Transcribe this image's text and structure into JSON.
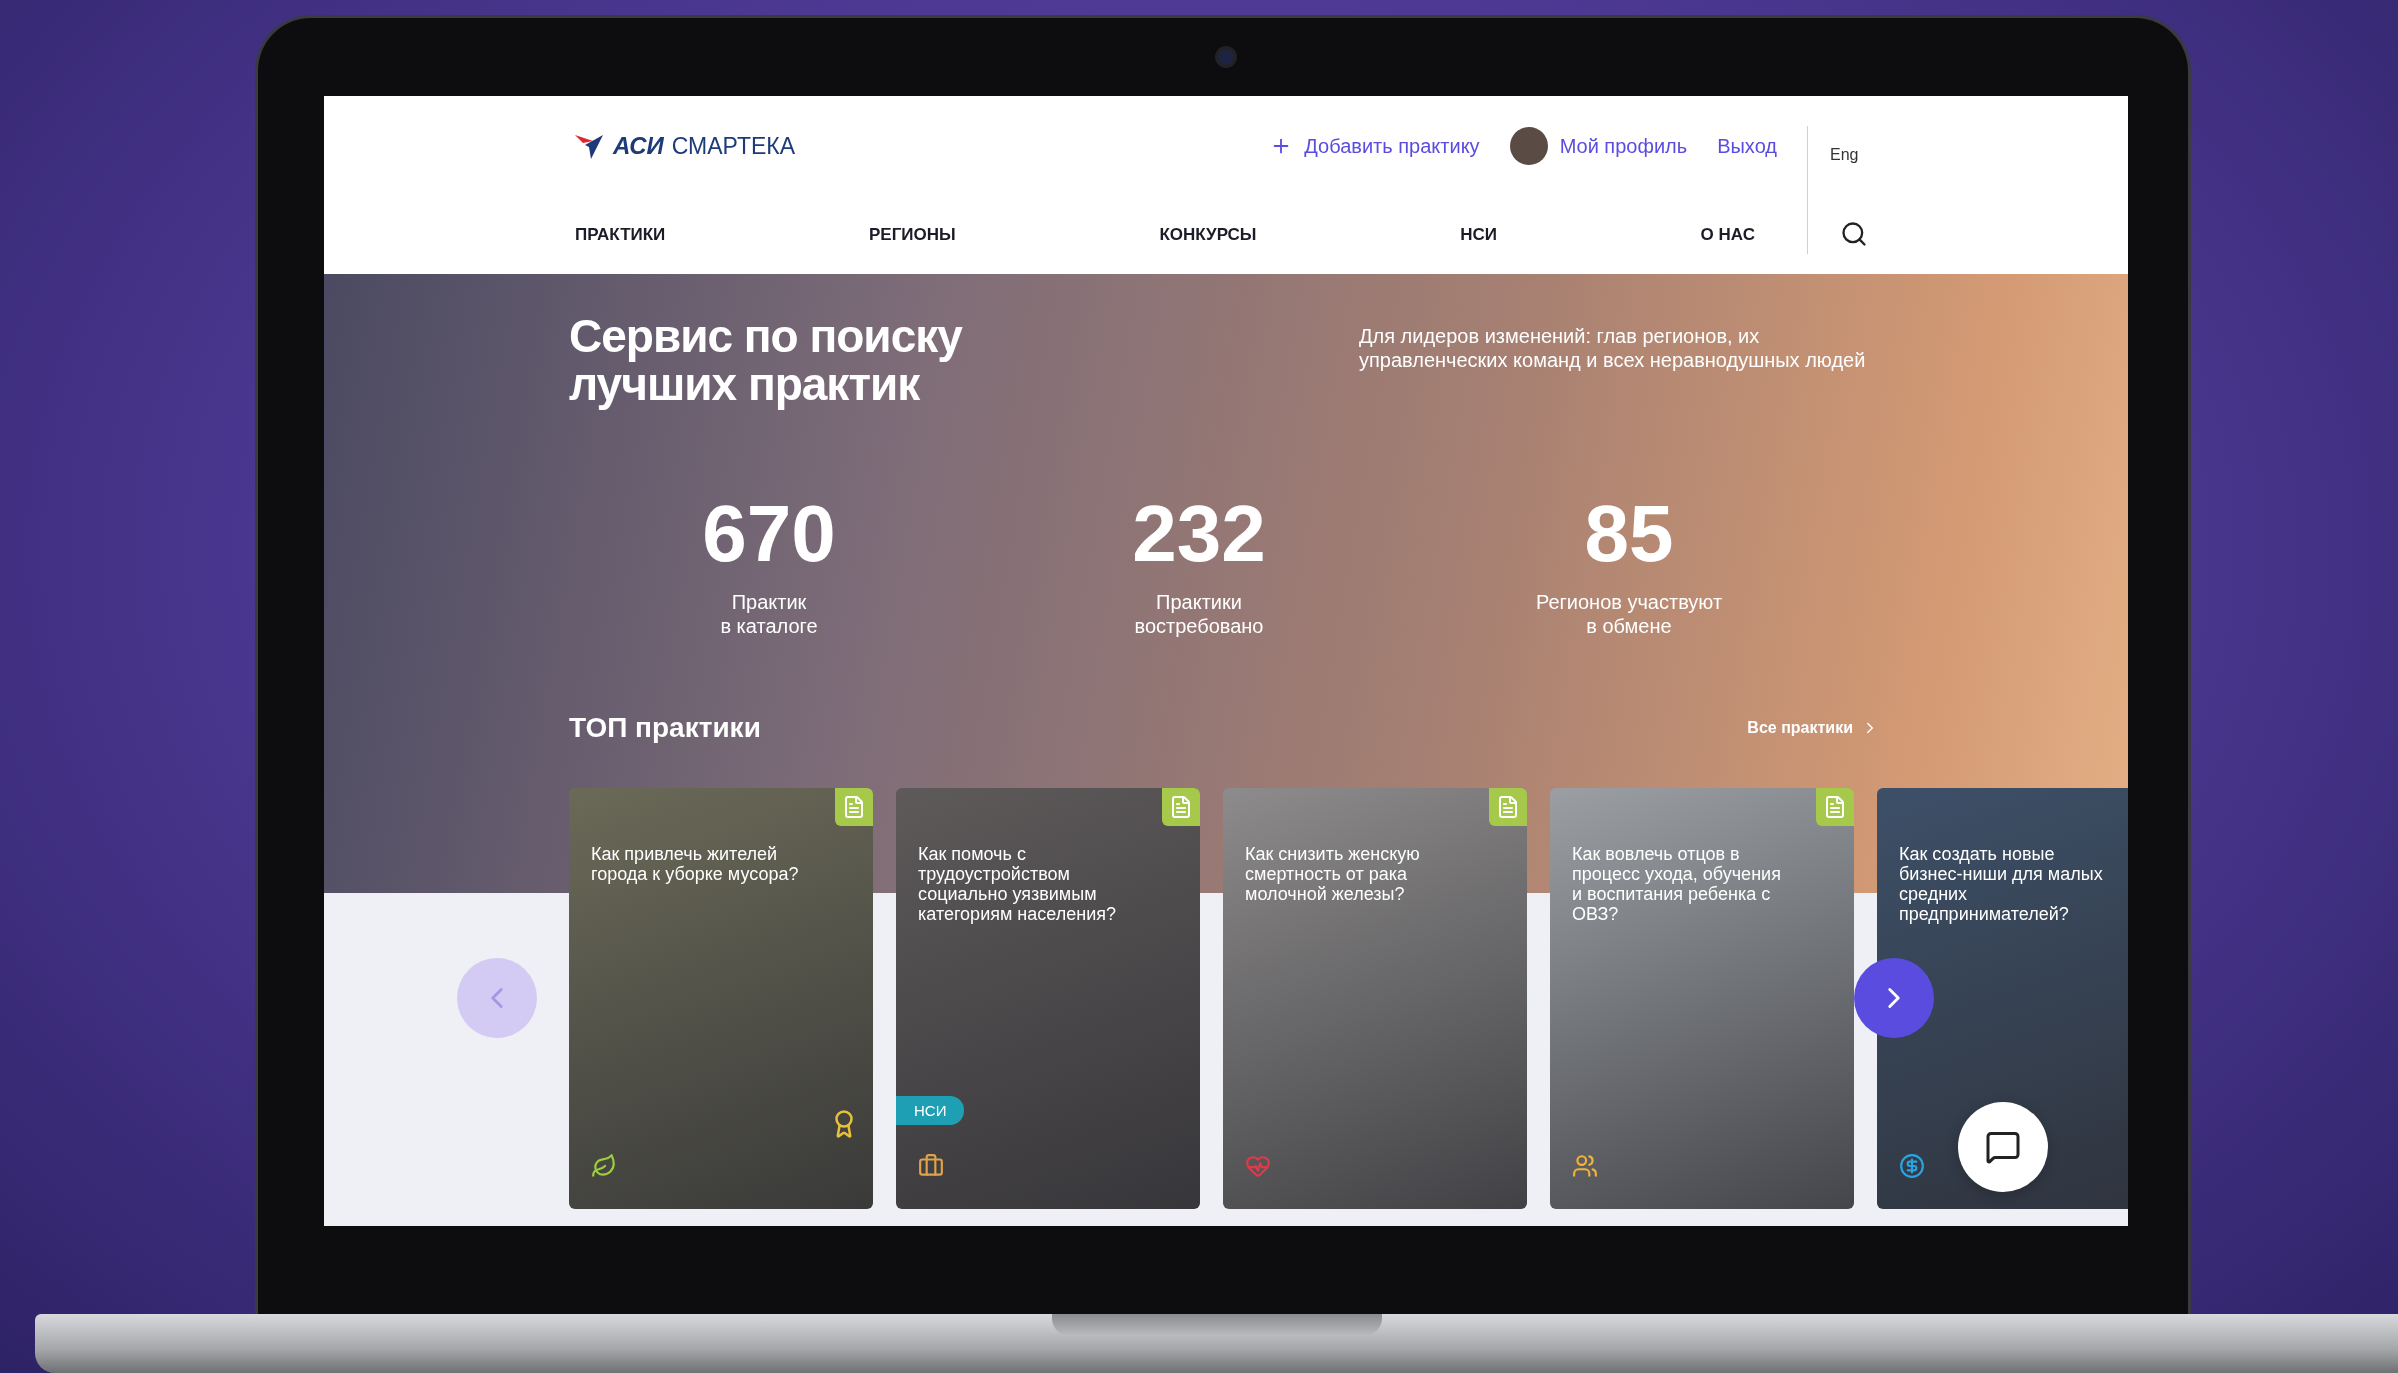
{
  "header": {
    "logo": {
      "mark": "АСИ",
      "name": "СМАРТЕКА"
    },
    "add_practice": "Добавить практику",
    "profile": "Мой профиль",
    "logout": "Выход",
    "language": "Eng",
    "nav": [
      "ПРАКТИКИ",
      "РЕГИОНЫ",
      "КОНКУРСЫ",
      "НСИ",
      "О НАС"
    ]
  },
  "hero": {
    "title": "Сервис по поиску лучших практик",
    "subtitle": "Для лидеров изменений: глав регионов, их управленческих команд и всех неравнодушных людей",
    "stats": [
      {
        "value": "670",
        "label": "Практик\nв каталоге"
      },
      {
        "value": "232",
        "label": "Практики\nвостребовано"
      },
      {
        "value": "85",
        "label": "Регионов участвуют\nв обмене"
      }
    ]
  },
  "top_practices": {
    "heading": "ТОП практики",
    "all_link": "Все практики",
    "prev": {
      "disabled": true
    },
    "next": {
      "disabled": false
    },
    "cards": [
      {
        "title": "Как привлечь жителей города к уборке мусора?",
        "kind": "ecology",
        "awarded": true,
        "color": "#6b6a58"
      },
      {
        "title": "Как помочь с трудоустройством социально уязвимым категориям населения?",
        "kind": "work",
        "badge": "НСИ",
        "color": "#5e5a5a"
      },
      {
        "title": "Как снизить женскую смертность от рака молочной железы?",
        "kind": "health",
        "color": "#8d8b8b"
      },
      {
        "title": "Как вовлечь отцов в процесс ухода, обучения и воспитания ребенка с ОВЗ?",
        "kind": "family",
        "color": "#9b9fa3"
      },
      {
        "title": "Как создать новые бизнес-ниши для малых средних предпринимателей?",
        "kind": "money",
        "color": "#3d5068"
      }
    ]
  }
}
